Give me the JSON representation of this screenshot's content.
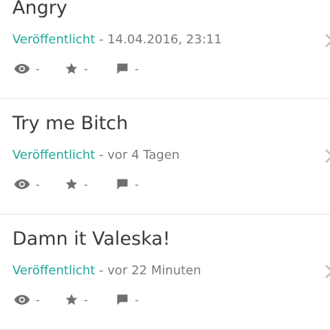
{
  "items": [
    {
      "title": "Angry",
      "status": "Veröffentlicht",
      "separator": " - ",
      "time": "14.04.2016, 23:11",
      "views": "-",
      "stars": "-",
      "comments": "-"
    },
    {
      "title": "Try me Bitch",
      "status": "Veröffentlicht",
      "separator": " - ",
      "time": "vor 4 Tagen",
      "views": "-",
      "stars": "-",
      "comments": "-"
    },
    {
      "title": "Damn it Valeska!",
      "status": "Veröffentlicht",
      "separator": " - ",
      "time": "vor 22 Minuten",
      "views": "-",
      "stars": "-",
      "comments": "-"
    }
  ],
  "icons": {
    "views": "eye-icon",
    "stars": "star-icon",
    "comments": "comment-icon",
    "arrow": "chevron-right-icon"
  },
  "colors": {
    "accent": "#1fa99a",
    "text": "#3b3b3b",
    "muted": "#7a7a7a",
    "divider": "#e3e3e3"
  }
}
